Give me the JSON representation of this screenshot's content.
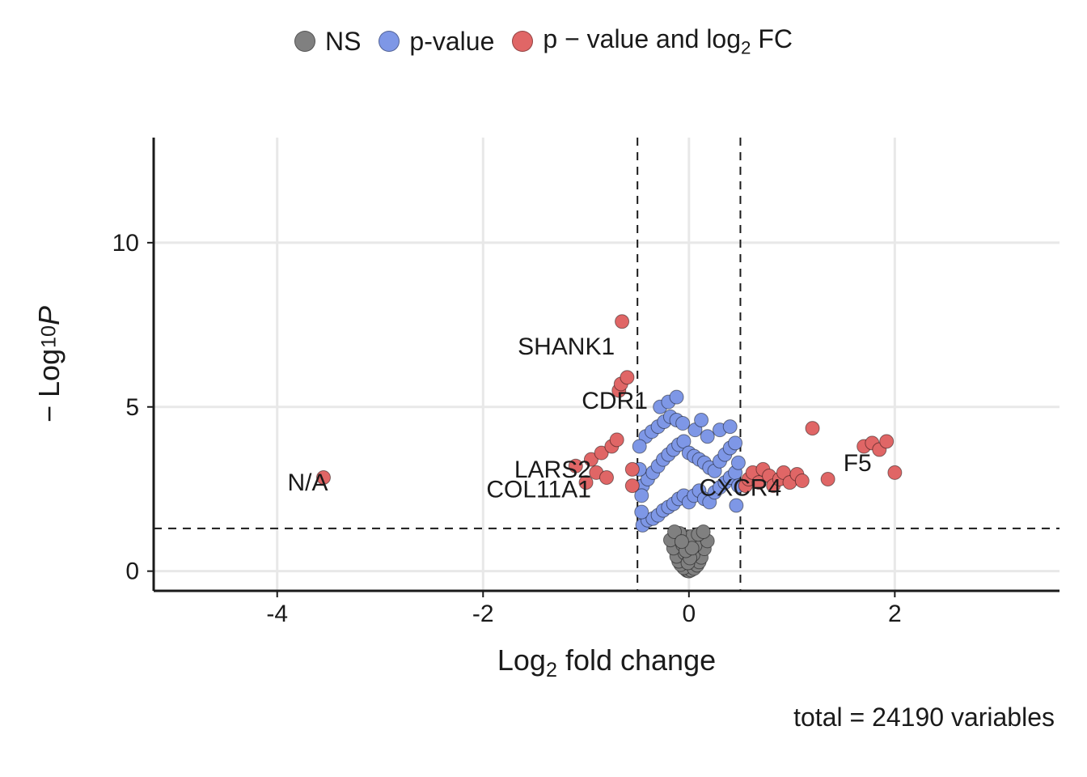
{
  "chart_data": {
    "type": "scatter",
    "xlabel_html": "Log<sub>2</sub> fold change",
    "ylabel_html": "− Log<sub>10</sub> <em class='it'>P</em>",
    "xlim": [
      -5.2,
      3.6
    ],
    "ylim": [
      -0.6,
      13.2
    ],
    "x_ticks": [
      -4,
      -2,
      0,
      2
    ],
    "y_ticks": [
      0,
      5,
      10
    ],
    "thresholds": {
      "logfc_neg": -0.5,
      "logfc_pos": 0.5,
      "neglog10p": 1.3
    },
    "legend": [
      {
        "label": "NS",
        "color": "#808080"
      },
      {
        "label": "p-value",
        "color": "#7E97E6"
      },
      {
        "label_html": "p − value and log<sub>2</sub> FC",
        "color": "#E06666"
      }
    ],
    "caption": "total = 24190 variables",
    "colors": {
      "ns": "#808080",
      "pval": "#7E97E6",
      "sig": "#E06666"
    },
    "annotations": [
      {
        "label": "SHANK1",
        "x": -0.72,
        "y": 6.6,
        "anchor": "end"
      },
      {
        "label": "CDR1",
        "x": -0.4,
        "y": 4.95,
        "anchor": "end"
      },
      {
        "label": "LARS2",
        "x": -0.95,
        "y": 2.85,
        "anchor": "end"
      },
      {
        "label": "COL11A1",
        "x": -0.95,
        "y": 2.25,
        "anchor": "end"
      },
      {
        "label": "CXCR4",
        "x": 0.1,
        "y": 2.3,
        "anchor": "start"
      },
      {
        "label": "F5",
        "x": 1.5,
        "y": 3.05,
        "anchor": "start"
      },
      {
        "label": "N/A",
        "x": -3.9,
        "y": 2.45,
        "anchor": "start"
      }
    ],
    "series": [
      {
        "name": "NS",
        "color": "#808080",
        "points": [
          {
            "x": -0.02,
            "y": 0.02
          },
          {
            "x": 0.0,
            "y": 0.0
          },
          {
            "x": 0.02,
            "y": 0.03
          },
          {
            "x": -0.05,
            "y": 0.1
          },
          {
            "x": 0.05,
            "y": 0.08
          },
          {
            "x": -0.08,
            "y": 0.2
          },
          {
            "x": 0.08,
            "y": 0.18
          },
          {
            "x": -0.1,
            "y": 0.3
          },
          {
            "x": 0.1,
            "y": 0.28
          },
          {
            "x": -0.12,
            "y": 0.45
          },
          {
            "x": 0.12,
            "y": 0.42
          },
          {
            "x": -0.04,
            "y": 0.55
          },
          {
            "x": 0.04,
            "y": 0.5
          },
          {
            "x": -0.15,
            "y": 0.7
          },
          {
            "x": 0.15,
            "y": 0.68
          },
          {
            "x": -0.06,
            "y": 0.8
          },
          {
            "x": 0.06,
            "y": 0.78
          },
          {
            "x": -0.18,
            "y": 0.95
          },
          {
            "x": 0.18,
            "y": 0.92
          },
          {
            "x": -0.02,
            "y": 1.05
          },
          {
            "x": 0.02,
            "y": 1.05
          },
          {
            "x": -0.09,
            "y": 1.15
          },
          {
            "x": 0.09,
            "y": 1.12
          },
          {
            "x": -0.14,
            "y": 1.2
          },
          {
            "x": 0.14,
            "y": 1.2
          },
          {
            "x": -0.01,
            "y": 0.25
          },
          {
            "x": 0.01,
            "y": 0.4
          },
          {
            "x": -0.03,
            "y": 0.62
          },
          {
            "x": 0.03,
            "y": 0.7
          },
          {
            "x": -0.07,
            "y": 0.9
          }
        ]
      },
      {
        "name": "p-value",
        "color": "#7E97E6",
        "points": [
          {
            "x": -0.45,
            "y": 1.4
          },
          {
            "x": -0.4,
            "y": 1.55
          },
          {
            "x": -0.35,
            "y": 1.6
          },
          {
            "x": -0.3,
            "y": 1.7
          },
          {
            "x": -0.25,
            "y": 1.85
          },
          {
            "x": -0.2,
            "y": 1.95
          },
          {
            "x": -0.15,
            "y": 2.05
          },
          {
            "x": -0.1,
            "y": 2.2
          },
          {
            "x": -0.05,
            "y": 2.3
          },
          {
            "x": 0.0,
            "y": 2.1
          },
          {
            "x": 0.05,
            "y": 2.3
          },
          {
            "x": 0.1,
            "y": 2.45
          },
          {
            "x": 0.15,
            "y": 2.2
          },
          {
            "x": 0.2,
            "y": 2.1
          },
          {
            "x": 0.25,
            "y": 2.4
          },
          {
            "x": 0.3,
            "y": 2.55
          },
          {
            "x": 0.35,
            "y": 2.7
          },
          {
            "x": 0.4,
            "y": 2.85
          },
          {
            "x": 0.45,
            "y": 3.0
          },
          {
            "x": -0.45,
            "y": 2.6
          },
          {
            "x": -0.4,
            "y": 2.8
          },
          {
            "x": -0.35,
            "y": 3.0
          },
          {
            "x": -0.3,
            "y": 3.2
          },
          {
            "x": -0.25,
            "y": 3.4
          },
          {
            "x": -0.2,
            "y": 3.55
          },
          {
            "x": -0.15,
            "y": 3.7
          },
          {
            "x": -0.1,
            "y": 3.85
          },
          {
            "x": -0.05,
            "y": 3.95
          },
          {
            "x": 0.0,
            "y": 3.6
          },
          {
            "x": 0.05,
            "y": 3.5
          },
          {
            "x": 0.1,
            "y": 3.4
          },
          {
            "x": 0.15,
            "y": 3.3
          },
          {
            "x": 0.2,
            "y": 3.15
          },
          {
            "x": 0.25,
            "y": 3.05
          },
          {
            "x": 0.3,
            "y": 3.35
          },
          {
            "x": 0.35,
            "y": 3.55
          },
          {
            "x": 0.4,
            "y": 3.75
          },
          {
            "x": 0.45,
            "y": 3.9
          },
          {
            "x": -0.42,
            "y": 4.1
          },
          {
            "x": -0.36,
            "y": 4.25
          },
          {
            "x": -0.3,
            "y": 4.4
          },
          {
            "x": -0.24,
            "y": 4.55
          },
          {
            "x": -0.18,
            "y": 4.7
          },
          {
            "x": -0.12,
            "y": 4.6
          },
          {
            "x": -0.06,
            "y": 4.5
          },
          {
            "x": 0.06,
            "y": 4.3
          },
          {
            "x": 0.18,
            "y": 4.1
          },
          {
            "x": 0.3,
            "y": 4.3
          },
          {
            "x": 0.4,
            "y": 4.4
          },
          {
            "x": -0.28,
            "y": 5.0
          },
          {
            "x": -0.2,
            "y": 5.15
          },
          {
            "x": -0.12,
            "y": 5.3
          },
          {
            "x": 0.12,
            "y": 4.6
          },
          {
            "x": -0.46,
            "y": 1.8
          },
          {
            "x": -0.46,
            "y": 2.3
          },
          {
            "x": -0.48,
            "y": 3.1
          },
          {
            "x": -0.48,
            "y": 3.8
          },
          {
            "x": 0.46,
            "y": 2.0
          },
          {
            "x": 0.48,
            "y": 2.6
          },
          {
            "x": 0.48,
            "y": 3.3
          }
        ]
      },
      {
        "name": "sig",
        "color": "#E06666",
        "points": [
          {
            "x": -3.55,
            "y": 2.85
          },
          {
            "x": -1.1,
            "y": 3.2
          },
          {
            "x": -1.0,
            "y": 2.7
          },
          {
            "x": -0.95,
            "y": 3.4
          },
          {
            "x": -0.9,
            "y": 3.0
          },
          {
            "x": -0.85,
            "y": 3.6
          },
          {
            "x": -0.8,
            "y": 2.85
          },
          {
            "x": -0.75,
            "y": 3.8
          },
          {
            "x": -0.7,
            "y": 4.0
          },
          {
            "x": -0.68,
            "y": 5.5
          },
          {
            "x": -0.66,
            "y": 5.7
          },
          {
            "x": -0.6,
            "y": 5.9
          },
          {
            "x": -0.65,
            "y": 7.6
          },
          {
            "x": -0.55,
            "y": 2.6
          },
          {
            "x": -0.55,
            "y": 3.1
          },
          {
            "x": 0.55,
            "y": 2.6
          },
          {
            "x": 0.58,
            "y": 2.8
          },
          {
            "x": 0.62,
            "y": 3.0
          },
          {
            "x": 0.68,
            "y": 2.7
          },
          {
            "x": 0.72,
            "y": 3.1
          },
          {
            "x": 0.78,
            "y": 2.9
          },
          {
            "x": 0.82,
            "y": 2.6
          },
          {
            "x": 0.88,
            "y": 2.8
          },
          {
            "x": 0.92,
            "y": 3.0
          },
          {
            "x": 0.98,
            "y": 2.7
          },
          {
            "x": 1.05,
            "y": 2.95
          },
          {
            "x": 1.1,
            "y": 2.75
          },
          {
            "x": 1.2,
            "y": 4.35
          },
          {
            "x": 1.35,
            "y": 2.8
          },
          {
            "x": 1.7,
            "y": 3.8
          },
          {
            "x": 1.78,
            "y": 3.9
          },
          {
            "x": 1.85,
            "y": 3.7
          },
          {
            "x": 1.92,
            "y": 3.95
          },
          {
            "x": 2.0,
            "y": 3.0
          }
        ]
      }
    ]
  }
}
